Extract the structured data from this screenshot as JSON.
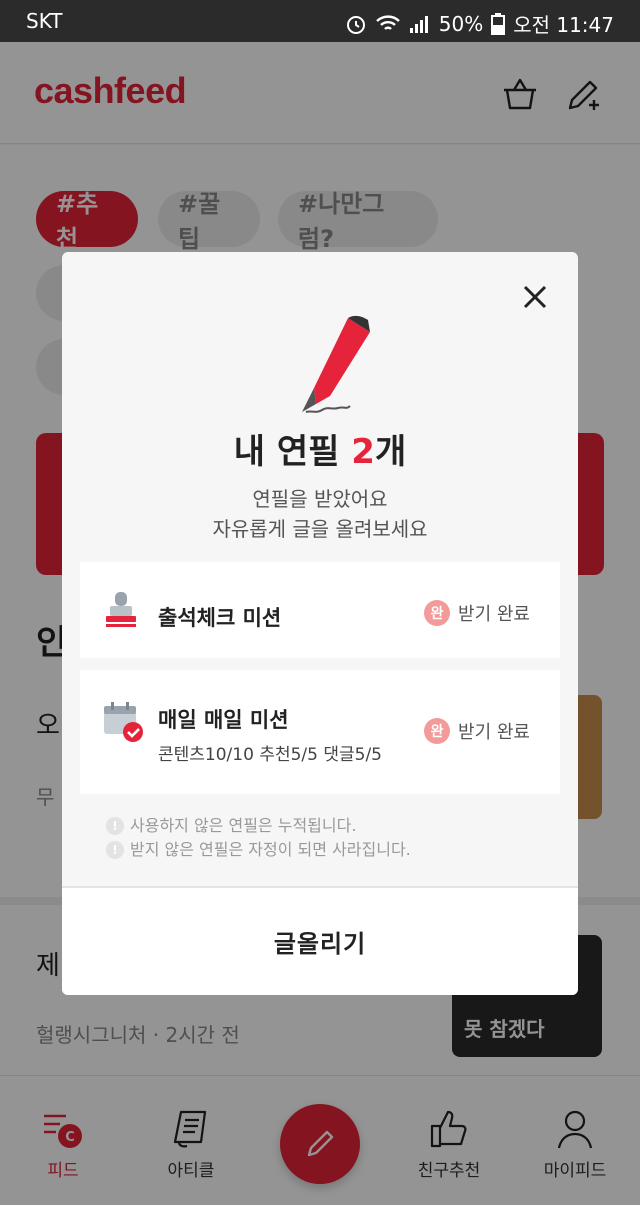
{
  "status_bar": {
    "carrier": "SKT",
    "battery": "50%",
    "time": "오전 11:47"
  },
  "header": {
    "logo": "cashfeed"
  },
  "tags": [
    "#추천",
    "#꿀팁",
    "#나만그럼?"
  ],
  "background": {
    "section_title_partial": "인",
    "item1_title_partial": "오",
    "item1_sub_partial": "무",
    "item2_title_partial": "제",
    "item2_meta": "헐랭시그니처 · 2시간 전",
    "thumb_caption": "못 참겠다"
  },
  "bottom_nav": {
    "items": [
      {
        "label": "피드"
      },
      {
        "label": "아티클"
      },
      {
        "label": "친구추천"
      },
      {
        "label": "마이피드"
      }
    ],
    "feed_badge": "C"
  },
  "modal": {
    "title_prefix": "내 연필 ",
    "title_count": "2",
    "title_suffix": "개",
    "desc_line1": "연필을 받았어요",
    "desc_line2": "자유롭게 글을 올려보세요",
    "missions": [
      {
        "name": "출석체크 미션",
        "badge": "완",
        "status": "받기 완료"
      },
      {
        "name": "매일 매일 미션",
        "progress": "콘텐츠10/10  추천5/5  댓글5/5",
        "badge": "완",
        "status": "받기 완료"
      }
    ],
    "notes": [
      "사용하지 않은 연필은 누적됩니다.",
      "받지 않은 연필은 자정이 되면 사라집니다."
    ],
    "note_icon": "!",
    "write_button": "글올리기"
  },
  "colors": {
    "accent": "#e5233a",
    "badge": "#f39a9a"
  }
}
